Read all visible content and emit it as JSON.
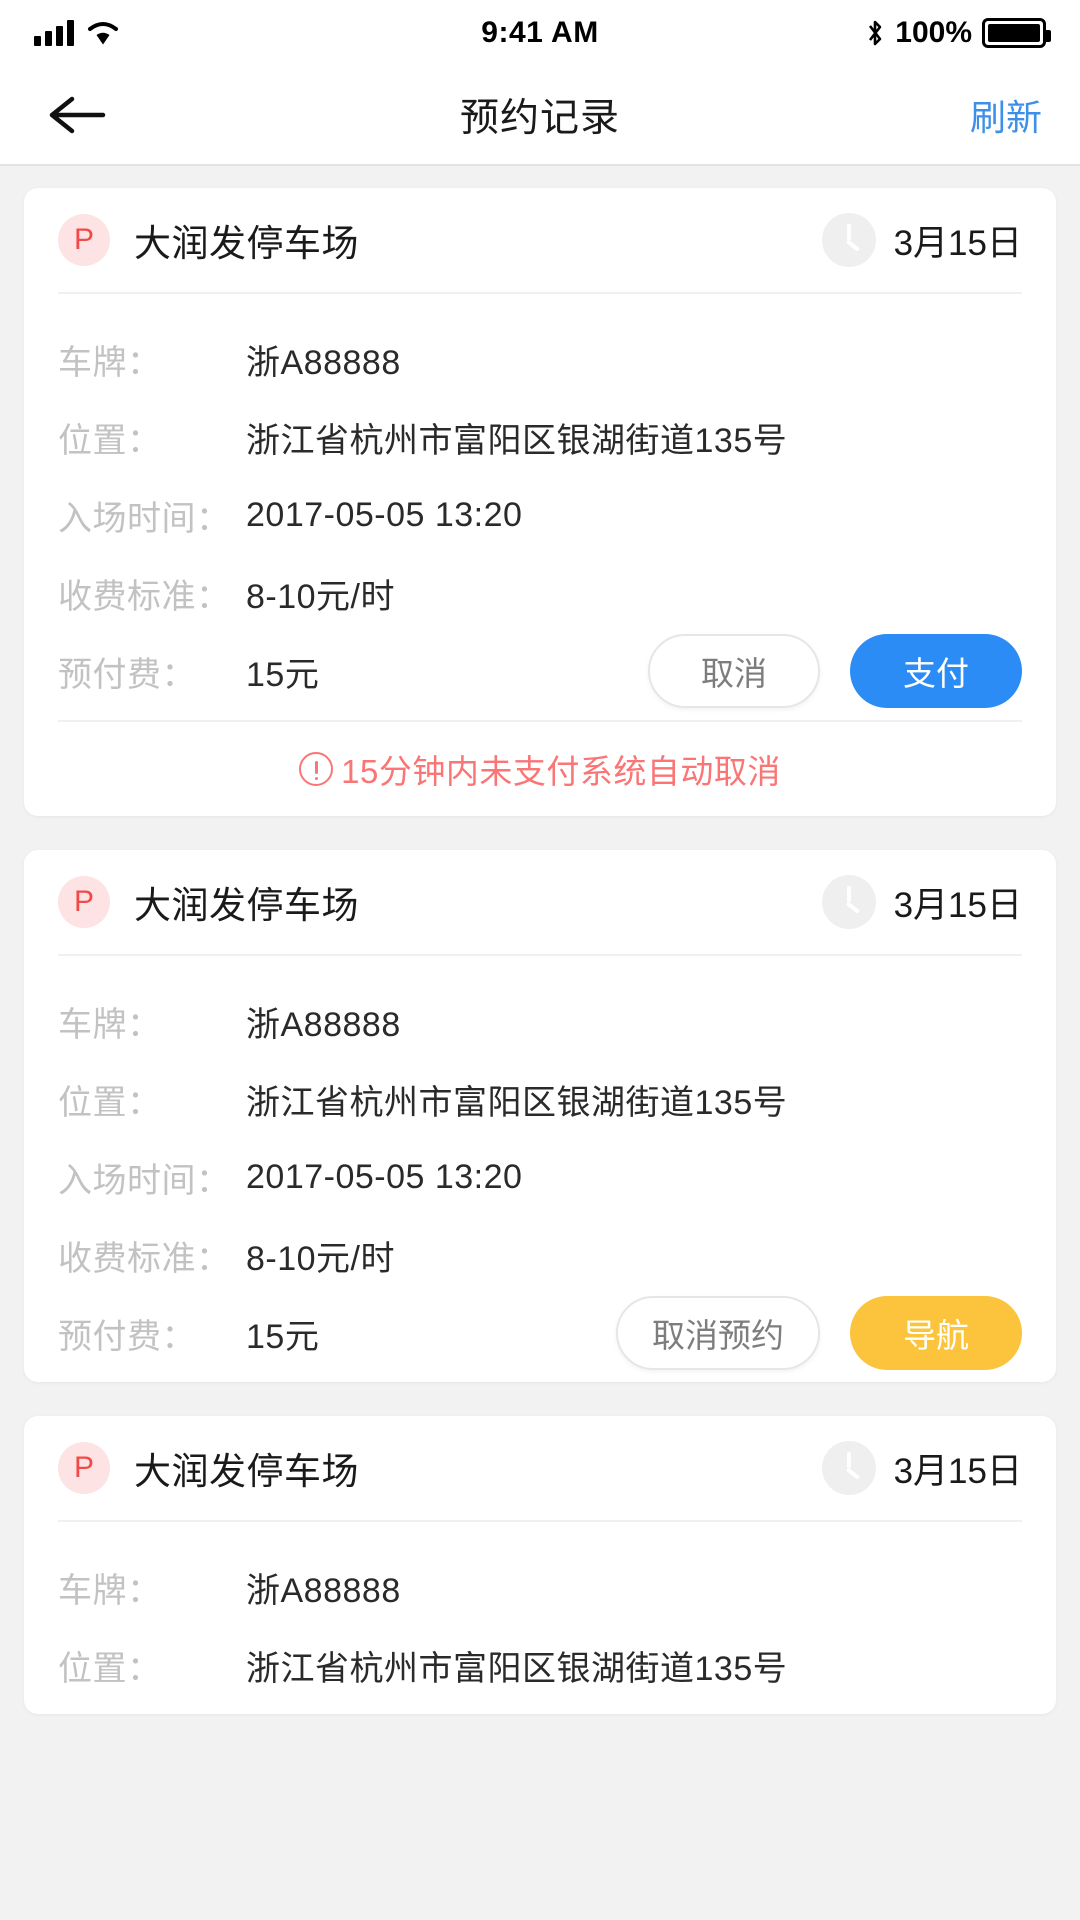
{
  "status_bar": {
    "time": "9:41 AM",
    "battery_percent": "100%",
    "signal_icon": "signal-bars-icon",
    "wifi_icon": "wifi-icon",
    "bluetooth_icon": "bluetooth-icon",
    "battery_icon": "battery-full-icon"
  },
  "nav": {
    "back_icon": "back-arrow-icon",
    "title": "预约记录",
    "action_label": "刷新",
    "action_color": "#3d8fe8"
  },
  "labels": {
    "plate": "车牌：",
    "location": "位置：",
    "entry_time": "入场时间：",
    "fee_standard": "收费标准：",
    "prepay": "预付费："
  },
  "colors": {
    "primary_button": "#2a8cf4",
    "warn_button": "#fbc43c",
    "notice_text": "#fa7575",
    "badge_bg": "#fde3e3",
    "badge_fg": "#f24a4a",
    "page_bg": "#f2f2f2"
  },
  "cards": [
    {
      "badge": "P",
      "lot_name": "大润发停车场",
      "clock_icon": "clock-icon",
      "date": "3月15日",
      "plate": "浙A88888",
      "location": "浙江省杭州市富阳区银湖街道135号",
      "entry_time": "2017-05-05 13:20",
      "fee_standard": "8-10元/时",
      "prepay": "15元",
      "secondary_button": "取消",
      "primary_button": "支付",
      "notice_icon": "exclamation-circle-icon",
      "notice": "15分钟内未支付系统自动取消"
    },
    {
      "badge": "P",
      "lot_name": "大润发停车场",
      "clock_icon": "clock-icon",
      "date": "3月15日",
      "plate": "浙A88888",
      "location": "浙江省杭州市富阳区银湖街道135号",
      "entry_time": "2017-05-05 13:20",
      "fee_standard": "8-10元/时",
      "prepay": "15元",
      "secondary_button": "取消预约",
      "primary_button": "导航"
    },
    {
      "badge": "P",
      "lot_name": "大润发停车场",
      "clock_icon": "clock-icon",
      "date": "3月15日",
      "plate": "浙A88888",
      "location": "浙江省杭州市富阳区银湖街道135号"
    }
  ]
}
